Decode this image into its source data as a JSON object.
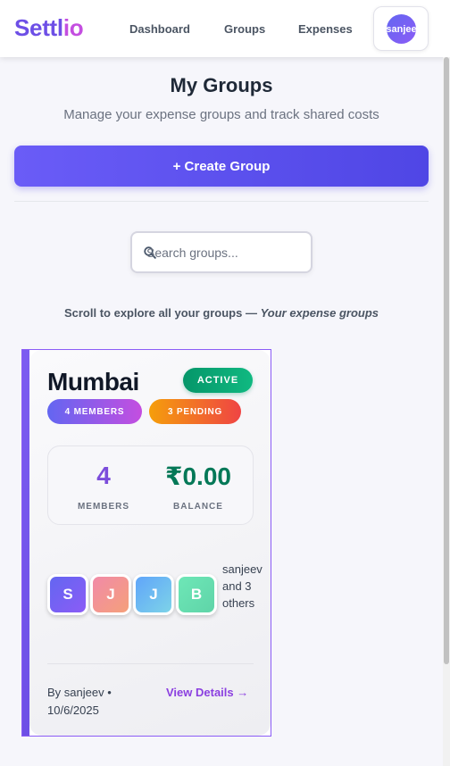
{
  "header": {
    "logo_main": "Settl",
    "logo_accent": "io",
    "nav": [
      {
        "label": "Dashboard"
      },
      {
        "label": "Groups"
      },
      {
        "label": "Expenses"
      }
    ],
    "user_avatar_text": "sanjee"
  },
  "main": {
    "title": "My Groups",
    "subtitle": "Manage your expense groups and track shared costs",
    "create_button": "+ Create Group",
    "search": {
      "placeholder": "Search groups...",
      "value": ""
    },
    "explore_text": "Scroll to explore all your groups — ",
    "explore_emphasis": "Your expense groups"
  },
  "group_card": {
    "name": "Mumbai",
    "status": "ACTIVE",
    "members_badge": "4 MEMBERS",
    "pending_badge": "3 PENDING",
    "members_value": "4",
    "members_label": "MEMBERS",
    "balance_value": "₹0.00",
    "balance_label": "BALANCE",
    "avatars": [
      {
        "initial": "S"
      },
      {
        "initial": "J"
      },
      {
        "initial": "J"
      },
      {
        "initial": "B"
      }
    ],
    "others_text": "sanjeev and 3 others",
    "creator_text": "By sanjeev • 10/6/2025",
    "view_details": "View Details →"
  },
  "colors": {
    "brand_purple": "#6d4fe6",
    "active_green": "#10b981",
    "balance_green": "#047857",
    "members_purple": "#7c4ddb",
    "view_details_purple": "#8b3fe0"
  },
  "icons": {
    "search": "magnifier-icon"
  }
}
